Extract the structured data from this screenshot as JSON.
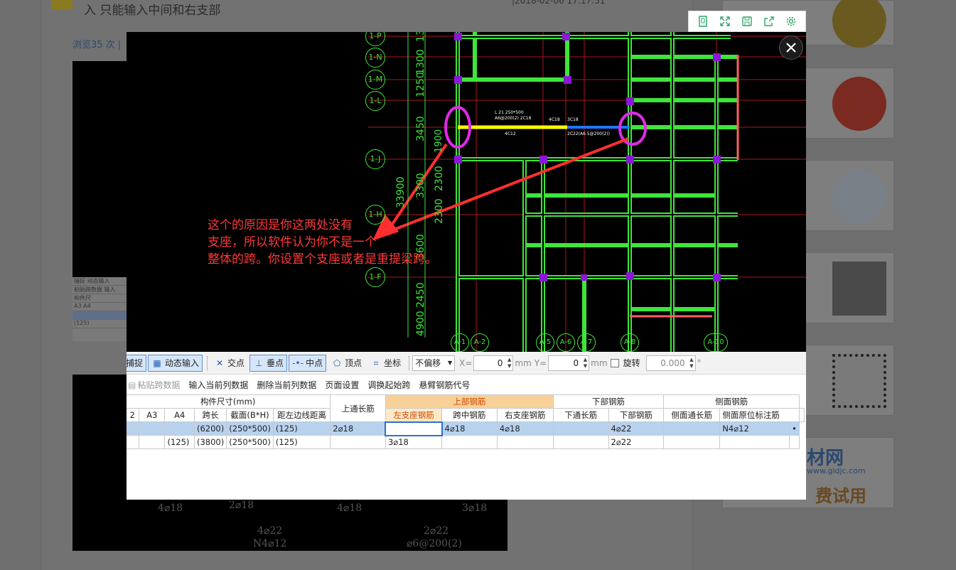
{
  "background": {
    "question_title": "入 只能输入中间和右支部",
    "meta_text": "|2018-02-06 17:17:51",
    "views_label": "浏览35 次 |",
    "strip_rows": [
      "捕捉  动态输入",
      "粘贴跨数据  输入",
      "构件尺",
      "A3  A4",
      "",
      "(125)"
    ],
    "cad_texts": [
      "4⌀18",
      "2⌀18",
      "4⌀18",
      "3⌀18",
      "4⌀22",
      "N4⌀12",
      "2⌀22",
      "⌀6@200(2)"
    ],
    "sidebar_ad": {
      "logo": "材网",
      "url": "www.gldjc.com",
      "promo": "费试用"
    }
  },
  "viewer_toolbar": {
    "tools": [
      {
        "name": "original-size-icon",
        "glyph": "▯"
      },
      {
        "name": "fullscreen-icon",
        "glyph": "⤢"
      },
      {
        "name": "save-icon",
        "glyph": "▣"
      },
      {
        "name": "share-icon",
        "glyph": "⇪"
      },
      {
        "name": "settings-icon",
        "glyph": "⚙"
      }
    ],
    "close_glyph": "✕"
  },
  "cad": {
    "axis_rows": [
      "1-P",
      "1-N",
      "1-M",
      "1-L",
      "1-J",
      "1-H",
      "1-F"
    ],
    "axis_cols": [
      "A-1",
      "A-2",
      "A-5",
      "A-6",
      "A-7",
      "A-8",
      "A-10"
    ],
    "dims_vertical": [
      "1300",
      "1300",
      "1250",
      "3450",
      "1900",
      "2300",
      "3300",
      "33900",
      "2300",
      "3600",
      "2450",
      "4900"
    ],
    "beam_label_1": "L 21  250*500",
    "beam_label_2": "A6@200(2)  2C18",
    "beam_label_3": "4C18",
    "beam_label_4": "4C12",
    "beam_label_5": "3C18",
    "beam_label_6": "2C22(A6.5@200(2))",
    "annotation_lines": [
      "这个的原因是你这两处没有",
      "支座，所以软件认为你不是一个",
      "整体的跨。你设置个支座或者是重提梁跨。"
    ]
  },
  "snap_toolbar": {
    "capture": "捕捉",
    "dynamic_input": "动态输入",
    "intersection": "交点",
    "perpendicular": "垂点",
    "midpoint": "中点",
    "vertex": "顶点",
    "coordinate": "坐标",
    "offset_value": "不偏移",
    "x_label": "X=",
    "x_value": "0",
    "unit1": "mm",
    "y_label": "Y=",
    "y_value": "0",
    "unit2": "mm",
    "rotate_label": "旋转",
    "rotate_value": "0.000",
    "degree": "°"
  },
  "actions": [
    {
      "label": "粘贴跨数据",
      "enabled": false
    },
    {
      "label": "输入当前列数据",
      "enabled": true
    },
    {
      "label": "删除当前列数据",
      "enabled": true
    },
    {
      "label": "页面设置",
      "enabled": true
    },
    {
      "label": "调换起始跨",
      "enabled": true
    },
    {
      "label": "悬臂钢筋代号",
      "enabled": true
    }
  ],
  "grid": {
    "group_headers": {
      "size": "构件尺寸(mm)",
      "top_long": "上通长筋",
      "top_rebar": "上部钢筋",
      "bottom_rebar": "下部钢筋",
      "side_rebar": "侧面钢筋"
    },
    "columns": [
      "2",
      "A3",
      "A4",
      "跨长",
      "截面(B*H)",
      "距左边线距离",
      "左支座钢筋",
      "跨中钢筋",
      "右支座钢筋",
      "下通长筋",
      "下部钢筋",
      "侧面通长筋",
      "侧面原位标注筋"
    ],
    "rows": [
      {
        "c2": "",
        "a3": "",
        "a4": "",
        "span": "(6200)",
        "section": "(250*500)",
        "dist": "(125)",
        "top_long": "2⌀18",
        "left": "",
        "mid": "4⌀18",
        "right": "4⌀18",
        "bot_long": "",
        "bottom": "4⌀22",
        "side_long": "",
        "side": "N4⌀12",
        "trail": "•"
      },
      {
        "c2": "",
        "a3": "",
        "a4": "(125)",
        "span": "(3800)",
        "section": "(250*500)",
        "dist": "(125)",
        "top_long": "",
        "left": "3⌀18",
        "mid": "",
        "right": "",
        "bot_long": "",
        "bottom": "2⌀22",
        "side_long": "",
        "side": "",
        "trail": ""
      }
    ]
  }
}
